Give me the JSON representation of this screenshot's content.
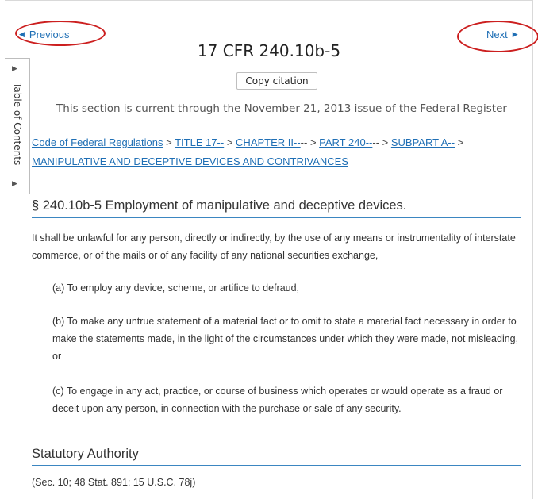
{
  "nav": {
    "previous_label": "Previous",
    "next_label": "Next",
    "annotation_color": "#cc1f1f"
  },
  "document": {
    "title": "17 CFR 240.10b-5",
    "copy_citation_label": "Copy citation",
    "currency_note": "This section is current through the November 21, 2013 issue of the Federal Register"
  },
  "toc": {
    "label": "Table of Contents"
  },
  "breadcrumb": {
    "items": [
      "Code of Federal Regulations",
      "TITLE 17--",
      "CHAPTER II--",
      "PART 240--",
      "SUBPART A--",
      "MANIPULATIVE AND DECEPTIVE DEVICES AND CONTRIVANCES"
    ],
    "separators": [
      " > ",
      " > ",
      "-- > ",
      "-- > ",
      " > "
    ]
  },
  "section": {
    "heading": "§ 240.10b-5 Employment of manipulative and deceptive devices.",
    "intro": "It shall be unlawful for any person, directly or indirectly, by the use of any means or instrumentality of interstate commerce, or of the mails or of any facility of any national securities exchange,",
    "clause_a": "(a) To employ any device, scheme, or artifice to defraud,",
    "clause_b": "(b) To make any untrue statement of a material fact or to omit to state a material fact necessary in order to make the statements made, in the light of the circumstances under which they were made, not misleading, or",
    "clause_c": "(c) To engage in any act, practice, or course of business which operates or would operate as a fraud or deceit upon any person, in connection with the purchase or sale of any security."
  },
  "authority": {
    "heading": "Statutory Authority",
    "text": "(Sec. 10; 48 Stat. 891; 15 U.S.C. 78j)"
  },
  "colors": {
    "link": "#1f6fb5",
    "rule": "#3b86c1"
  }
}
